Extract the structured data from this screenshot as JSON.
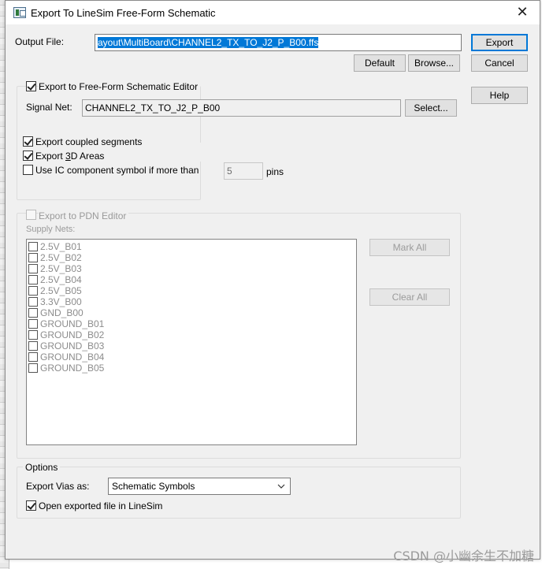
{
  "window": {
    "title": "Export To LineSim Free-Form Schematic",
    "close_glyph": "✕"
  },
  "output_file": {
    "label": "Output File:",
    "value": "ayout\\MultiBoard\\CHANNEL2_TX_TO_J2_P_B00.ffs"
  },
  "buttons": {
    "export": "Export",
    "cancel": "Cancel",
    "help": "Help",
    "default": "Default",
    "browse": "Browse...",
    "select": "Select...",
    "mark_all": "Mark All",
    "clear_all": "Clear All"
  },
  "ffs_group": {
    "checkbox_label": "Export to Free-Form Schematic Editor",
    "checked": true,
    "signal_net_label": "Signal Net:",
    "signal_net_value": "CHANNEL2_TX_TO_J2_P_B00",
    "export_coupled_label": "Export coupled segments",
    "export_coupled_checked": true,
    "export_3d_label_pre": "Export ",
    "export_3d_label_u": "3",
    "export_3d_label_post": "D Areas",
    "export_3d_checked": true,
    "use_ic_label": "Use IC component symbol if more than",
    "use_ic_checked": false,
    "pins_value": "5",
    "pins_label": "pins"
  },
  "pdn_group": {
    "checkbox_label": "Export to PDN Editor",
    "checked": false,
    "supply_nets_label": "Supply Nets:",
    "supply_nets": [
      "2.5V_B01",
      "2.5V_B02",
      "2.5V_B03",
      "2.5V_B04",
      "2.5V_B05",
      "3.3V_B00",
      "GND_B00",
      "GROUND_B01",
      "GROUND_B02",
      "GROUND_B03",
      "GROUND_B04",
      "GROUND_B05"
    ]
  },
  "options_group": {
    "title": "Options",
    "export_vias_label": "Export Vias as:",
    "export_vias_value": "Schematic Symbols",
    "open_exported_label": "Open exported file in LineSim",
    "open_exported_checked": true
  },
  "watermark": "CSDN @小幽余生不加糖",
  "colors": {
    "dialog_bg": "#f0f0f0",
    "selection": "#0078d7",
    "disabled_text": "#9a9a9a"
  }
}
